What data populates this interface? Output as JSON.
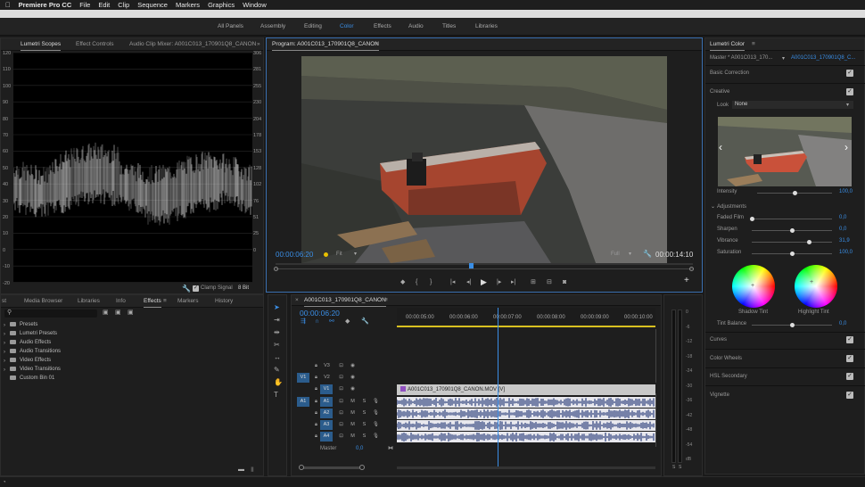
{
  "menubar": {
    "app": "Premiere Pro CC",
    "items": [
      "File",
      "Edit",
      "Clip",
      "Sequence",
      "Markers",
      "Graphics",
      "Window"
    ]
  },
  "workspace": {
    "tabs": [
      "All Panels",
      "Assembly",
      "Editing",
      "Color",
      "Effects",
      "Audio",
      "Titles",
      "Libraries"
    ],
    "active": "Color"
  },
  "scopes": {
    "tabs": [
      "Lumetri Scopes",
      "Effect Controls",
      "Audio Clip Mixer: A001C013_170901Q8_CANON"
    ],
    "left_scale": [
      "120",
      "110",
      "100",
      "90",
      "80",
      "70",
      "60",
      "50",
      "40",
      "30",
      "20",
      "10",
      "0",
      "-10",
      "-20"
    ],
    "right_scale": [
      "306",
      "281",
      "255",
      "230",
      "204",
      "178",
      "153",
      "128",
      "102",
      "76",
      "51",
      "25",
      "0"
    ],
    "clamp_label": "Clamp Signal",
    "bit_depth": "8 Bit"
  },
  "program": {
    "title": "Program: A001C013_170901Q8_CANON",
    "timecode": "00:00:06:20",
    "fit": "Fit",
    "quality": "Full",
    "duration": "00:00:14:10"
  },
  "lumetri": {
    "title": "Lumetri Color",
    "master": "Master * A001C013_170...",
    "clip": "A001C013_170901Q8_C...",
    "basic_correction": "Basic Correction",
    "creative": "Creative",
    "look_label": "Look",
    "look_value": "None",
    "intensity_label": "Intensity",
    "intensity_value": "100,0",
    "adjustments": "Adjustments",
    "faded_film_label": "Faded Film",
    "faded_film_value": "0,0",
    "sharpen_label": "Sharpen",
    "sharpen_value": "0,0",
    "vibrance_label": "Vibrance",
    "vibrance_value": "31,9",
    "saturation_label": "Saturation",
    "saturation_value": "100,0",
    "shadow_tint": "Shadow Tint",
    "highlight_tint": "Highlight Tint",
    "tint_balance_label": "Tint Balance",
    "tint_balance_value": "0,0",
    "sections": [
      "Curves",
      "Color Wheels",
      "HSL Secondary",
      "Vignette"
    ]
  },
  "effects": {
    "tabs": [
      "st",
      "Media Browser",
      "Libraries",
      "Info",
      "Effects",
      "Markers",
      "History"
    ],
    "items": [
      "Presets",
      "Lumetri Presets",
      "Audio Effects",
      "Audio Transitions",
      "Video Effects",
      "Video Transitions",
      "Custom Bin 01"
    ]
  },
  "timeline": {
    "title": "A001C013_170901Q8_CANON",
    "timecode": "00:00:06:20",
    "ruler": [
      "00:00:05:00",
      "00:00:06:00",
      "00:00:07:00",
      "00:00:08:00",
      "00:00:09:00",
      "00:00:10:00"
    ],
    "video_tracks": [
      "V3",
      "V2",
      "V1"
    ],
    "audio_tracks": [
      "A1",
      "A2",
      "A3",
      "A4"
    ],
    "src_v": "V1",
    "src_a": "A1",
    "master_label": "Master",
    "master_value": "0,0",
    "clip_name": "A001C013_170901Q8_CANON.MOV [V]",
    "mute": "M",
    "solo": "S"
  },
  "meter": {
    "scale": [
      "0",
      "-6",
      "-12",
      "-18",
      "-24",
      "-30",
      "-36",
      "-42",
      "-48",
      "-54",
      "dB"
    ],
    "solo": "S"
  }
}
